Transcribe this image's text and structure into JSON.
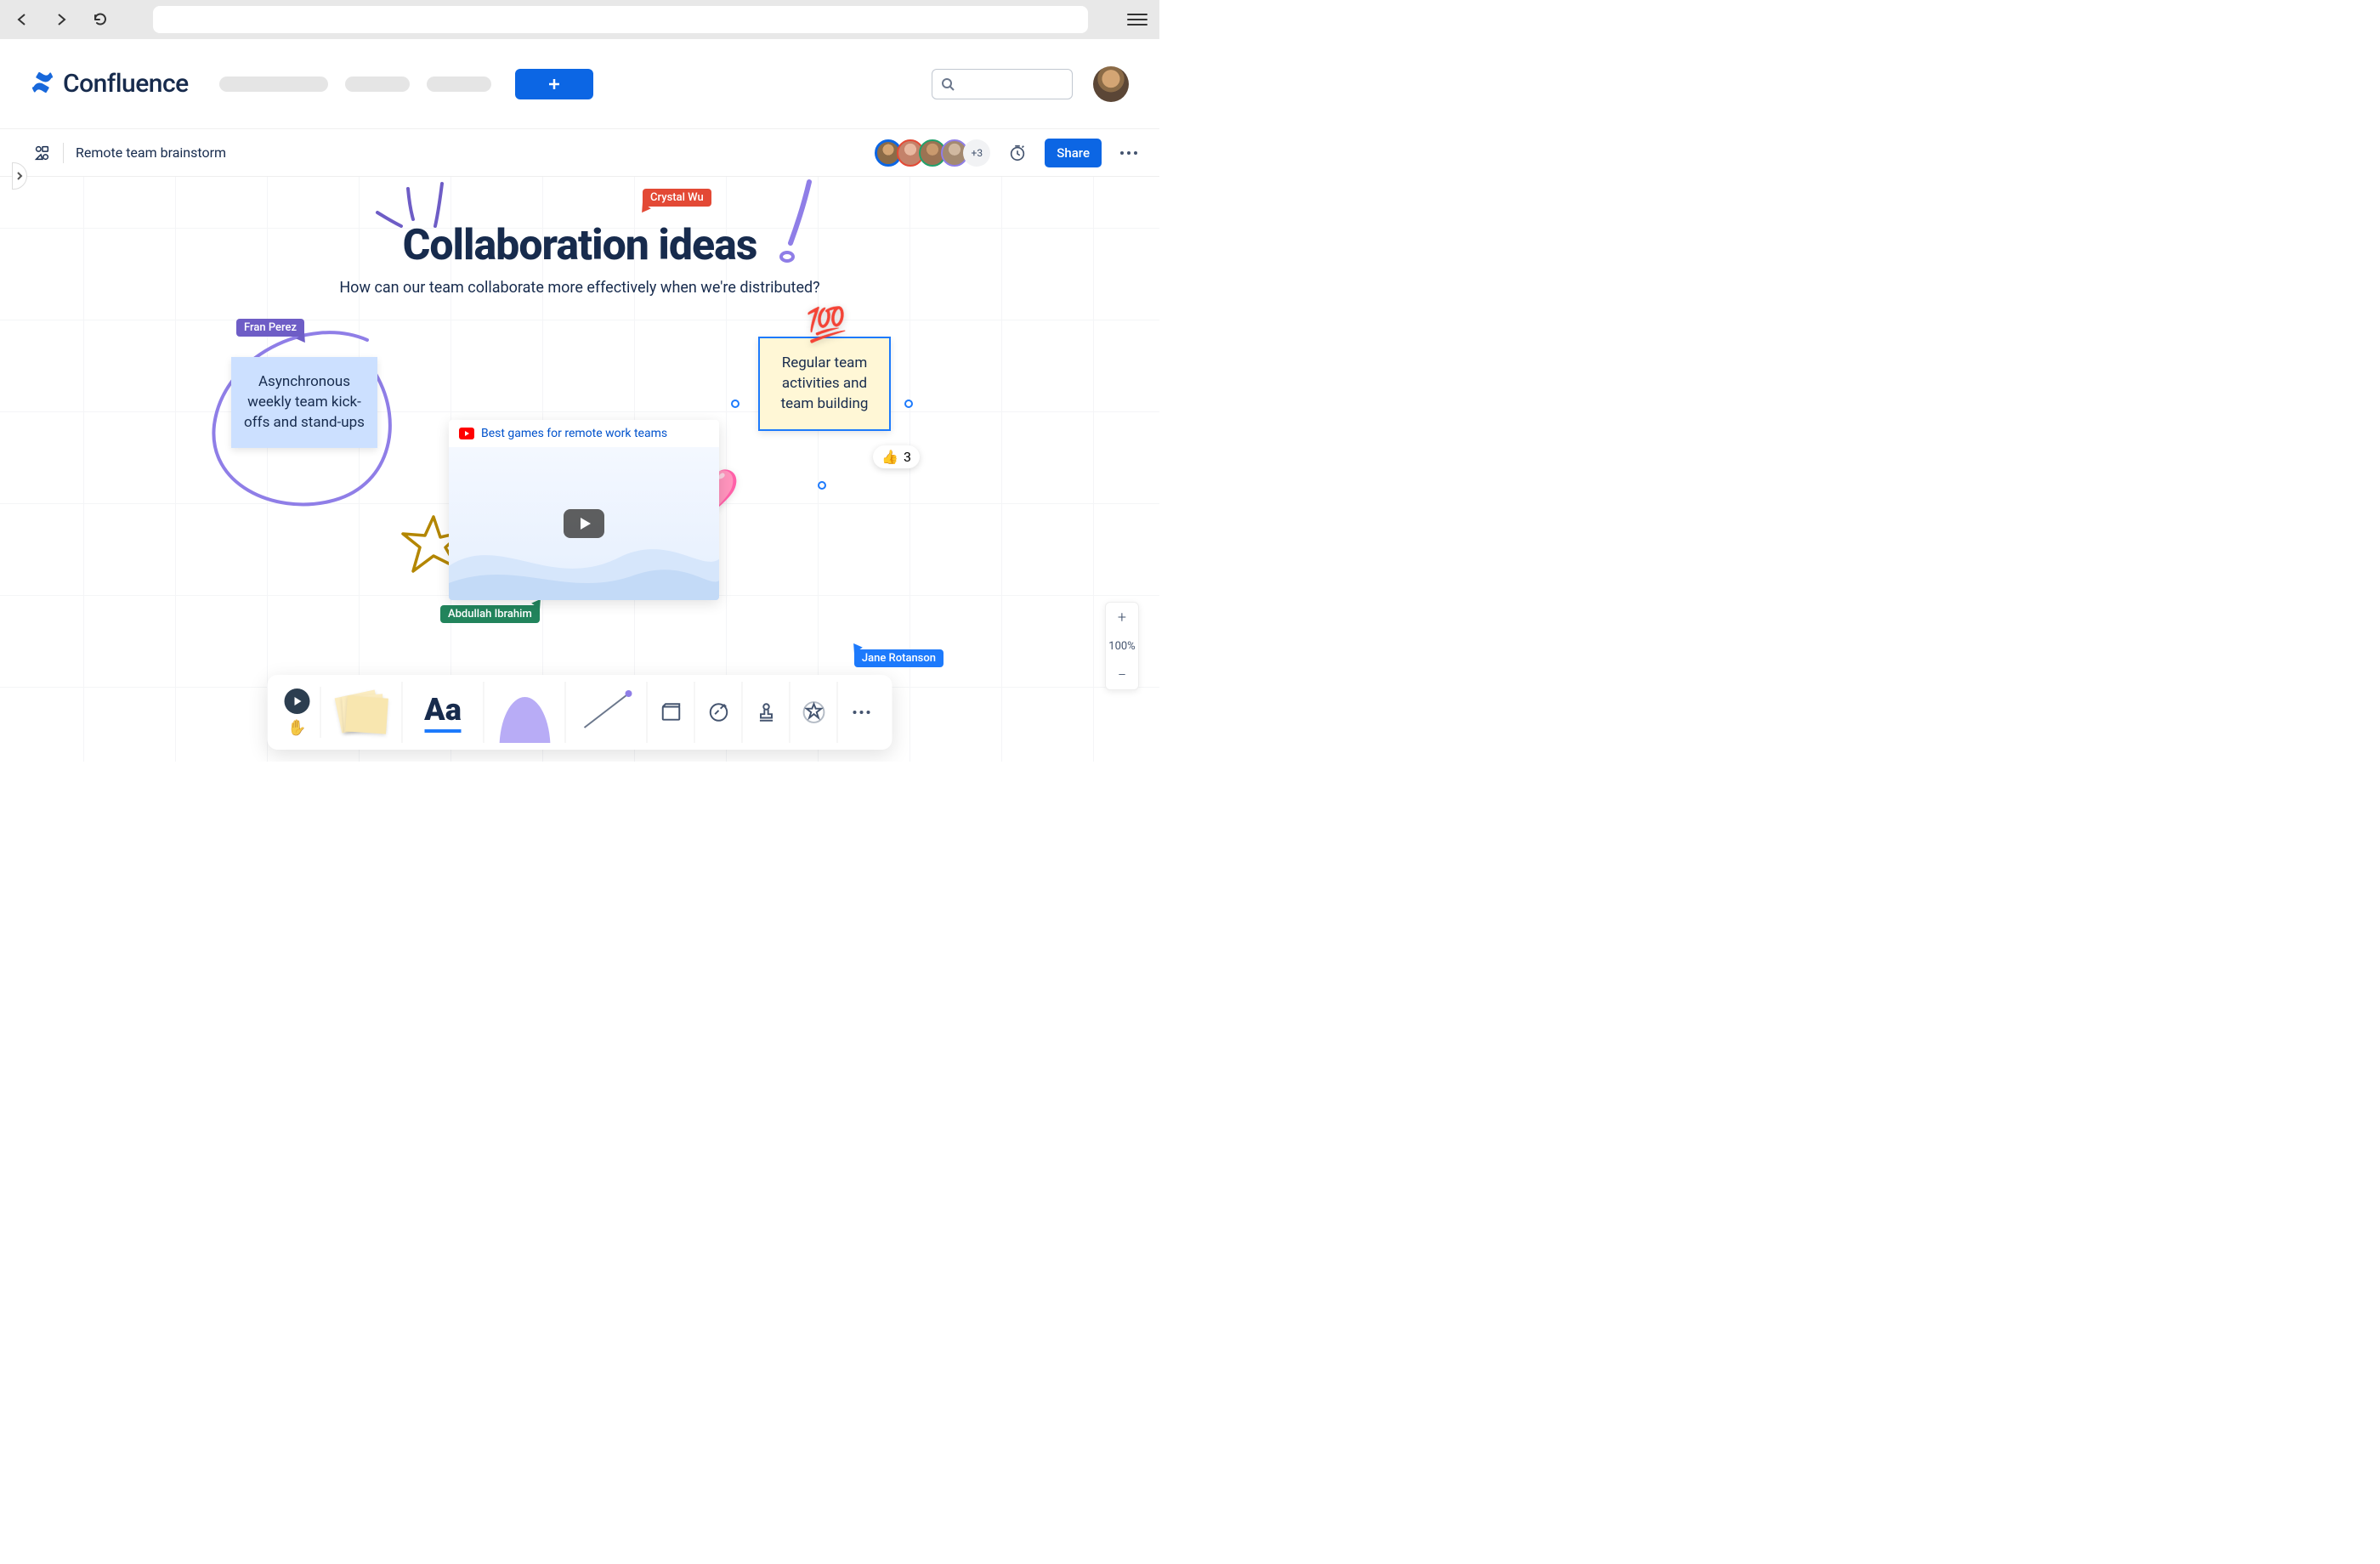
{
  "app": {
    "name": "Confluence"
  },
  "whiteboard": {
    "title": "Remote team brainstorm",
    "heading": "Collaboration ideas",
    "subheading": "How can our team collaborate more effectively when we're distributed?"
  },
  "header": {
    "share_label": "Share",
    "presence_overflow": "+3"
  },
  "cursors": {
    "red": "Crystal Wu",
    "purple": "Fran Perez",
    "green": "Abdullah Ibrahim",
    "blue": "Jane Rotanson"
  },
  "stickies": {
    "blue": "Asynchronous weekly team kick-offs and stand-ups",
    "yellow": "Regular team activities and team building"
  },
  "reaction": {
    "emoji": "👍",
    "count": "3"
  },
  "video": {
    "title": "Best games for remote work teams"
  },
  "zoom": {
    "level": "100%"
  },
  "toolbar": {
    "text_glyph": "Aa"
  },
  "stickers": {
    "hundred": "💯",
    "heart": "🩷"
  }
}
